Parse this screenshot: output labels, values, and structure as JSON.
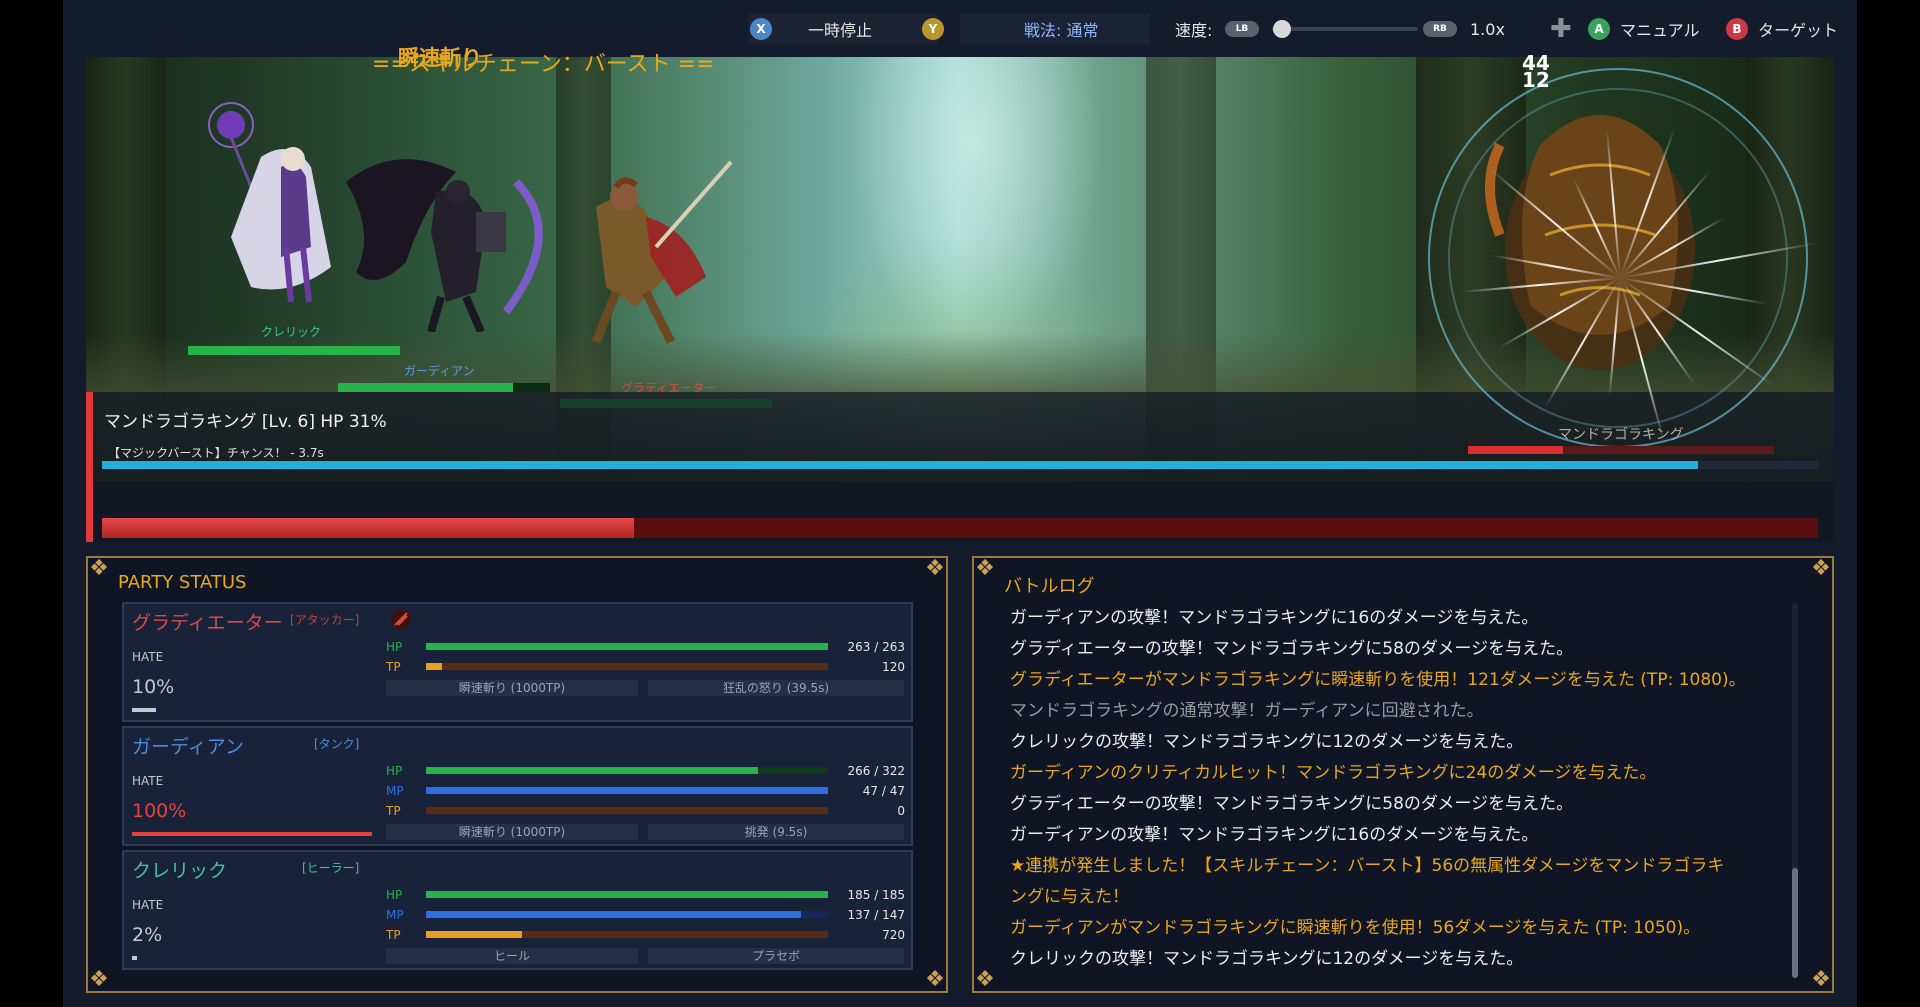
{
  "controls": {
    "pause_key": "X",
    "pause_label": "一時停止",
    "tactics_key": "Y",
    "tactics_label": "戦法: 通常",
    "speed_label": "速度:",
    "speed_down_key": "LB",
    "speed_up_key": "RB",
    "speed_value": "1.0x",
    "manual_key": "A",
    "manual_label": "マニュアル",
    "target_key": "B",
    "target_label": "ターゲット"
  },
  "scene": {
    "skill_popup": "瞬速斬り",
    "chain_name": "==スキルチェーン：バースト ==",
    "damage_numbers": [
      "44",
      "12"
    ],
    "units": [
      {
        "name": "クレリック",
        "name_color": "#3fc08a",
        "hp_fraction": 1.0
      },
      {
        "name": "ガーディアン",
        "name_color": "#5a96e8",
        "hp_fraction": 0.826
      },
      {
        "name": "グラディエーター",
        "name_color": "#d84a4a",
        "hp_fraction": 1.0
      }
    ],
    "boss_tag": "マンドラゴラキング",
    "boss_mini_hp_fraction": 0.31
  },
  "boss": {
    "title": "マンドラゴラキング [Lv. 6]   HP 31%",
    "burst_text": "【マジックバースト】チャンス！ - 3.7s",
    "burst_fraction": 0.93,
    "hp_fraction": 0.31
  },
  "party": {
    "title": "PARTY STATUS",
    "hate_label": "HATE",
    "members": [
      {
        "name": "グラディエーター",
        "role": "[アタッカー]",
        "name_color": "#e04848",
        "hate": "10%",
        "hate_fraction": 0.1,
        "hate_color": "#c8c8d0",
        "hp_label": "HP",
        "hp": "263 / 263",
        "hp_fraction": 1.0,
        "tp_label": "TP",
        "tp": "120",
        "tp_fraction": 0.04,
        "skills": [
          "瞬速斬り (1000TP)",
          "狂乱の怒り (39.5s)"
        ]
      },
      {
        "name": "ガーディアン",
        "role": "[タンク]",
        "name_color": "#4a8ae0",
        "hate": "100%",
        "hate_fraction": 1.0,
        "hate_color": "#e84040",
        "hp_label": "HP",
        "hp": "266 / 322",
        "hp_fraction": 0.826,
        "mp_label": "MP",
        "mp": "47 / 47",
        "mp_fraction": 1.0,
        "tp_label": "TP",
        "tp": "0",
        "tp_fraction": 0.0,
        "skills": [
          "瞬速斬り (1000TP)",
          "挑発 (9.5s)"
        ]
      },
      {
        "name": "クレリック",
        "role": "[ヒーラー]",
        "name_color": "#3fc0a0",
        "hate": "2%",
        "hate_fraction": 0.02,
        "hate_color": "#c8c8d0",
        "hp_label": "HP",
        "hp": "185 / 185",
        "hp_fraction": 1.0,
        "mp_label": "MP",
        "mp": "137 / 147",
        "mp_fraction": 0.932,
        "tp_label": "TP",
        "tp": "720",
        "tp_fraction": 0.24,
        "skills": [
          "ヒール",
          "プラセボ"
        ]
      }
    ]
  },
  "battle_log": {
    "title": "バトルログ",
    "lines": [
      {
        "text": "ガーディアンの攻撃！マンドラゴラキングに16のダメージを与えた。",
        "color": "#ececec"
      },
      {
        "text": "グラディエーターの攻撃！マンドラゴラキングに58のダメージを与えた。",
        "color": "#ececec"
      },
      {
        "text": "グラディエーターがマンドラゴラキングに瞬速斬りを使用！121ダメージを与えた (TP: 1080)。",
        "color": "#e8a81c"
      },
      {
        "text": "マンドラゴラキングの通常攻撃！ガーディアンに回避された。",
        "color": "#9a9aa4"
      },
      {
        "text": "クレリックの攻撃！マンドラゴラキングに12のダメージを与えた。",
        "color": "#ececec"
      },
      {
        "text": "ガーディアンのクリティカルヒット！マンドラゴラキングに24のダメージを与えた。",
        "color": "#e8a81c"
      },
      {
        "text": "グラディエーターの攻撃！マンドラゴラキングに58のダメージを与えた。",
        "color": "#ececec"
      },
      {
        "text": "ガーディアンの攻撃！マンドラゴラキングに16のダメージを与えた。",
        "color": "#ececec"
      },
      {
        "text": "★連携が発生しました！【スキルチェーン：バースト】56の無属性ダメージをマンドラゴラキ",
        "color": "#e8a81c"
      },
      {
        "text": "ングに与えた！",
        "color": "#e8a81c"
      },
      {
        "text": "ガーディアンがマンドラゴラキングに瞬速斬りを使用！56ダメージを与えた (TP: 1050)。",
        "color": "#e8a81c"
      },
      {
        "text": "クレリックの攻撃！マンドラゴラキングに12のダメージを与えた。",
        "color": "#ececec"
      }
    ]
  },
  "colors": {
    "hp": "#27b24a",
    "mp": "#2f6ee0",
    "tp": "#e8a020",
    "hp_track": "#0f3a1a",
    "mp_track": "#14285a",
    "tp_track": "#5a2a14"
  }
}
